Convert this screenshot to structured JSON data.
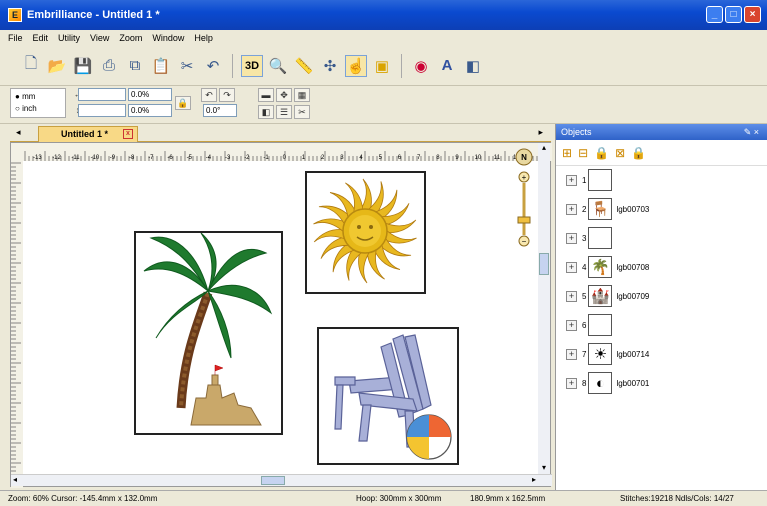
{
  "window": {
    "title": "Embrilliance - Untitled 1 *"
  },
  "menu": [
    "File",
    "Edit",
    "Utility",
    "View",
    "Zoom",
    "Window",
    "Help"
  ],
  "toolbar": {
    "icons": [
      "new-icon",
      "open-icon",
      "save-icon",
      "print-icon",
      "copy-icon",
      "paste-icon",
      "stitch-icon",
      "undo-icon",
      "3d-view-icon",
      "zoom-icon",
      "measure-icon",
      "hoop-icon",
      "select-icon",
      "fill-icon",
      "color-icon",
      "text-icon",
      "split-icon"
    ],
    "3d_label": "3D",
    "text_label": "A"
  },
  "units": {
    "mm": "mm",
    "inch": "inch"
  },
  "fields": {
    "width_pct": "0.0%",
    "height_pct": "0.0%",
    "rotation": "0.0°"
  },
  "doc_tab": {
    "label": "Untitled 1 *"
  },
  "ruler": [
    "-13",
    "-12",
    "-11",
    "-10",
    "-9",
    "-8",
    "-7",
    "-6",
    "-5",
    "-4",
    "-3",
    "-2",
    "-1",
    "0",
    "1",
    "2",
    "3",
    "4",
    "5",
    "6",
    "7",
    "8",
    "9",
    "10",
    "11",
    "12"
  ],
  "objects_panel": {
    "title": "Objects",
    "items": [
      {
        "num": "1",
        "name": "",
        "icon": "empty"
      },
      {
        "num": "2",
        "name": "lgb00703",
        "icon": "chair-icon"
      },
      {
        "num": "3",
        "name": "",
        "icon": "empty"
      },
      {
        "num": "4",
        "name": "lgb00708",
        "icon": "palm-icon"
      },
      {
        "num": "5",
        "name": "lgb00709",
        "icon": "sandcastle-icon"
      },
      {
        "num": "6",
        "name": "",
        "icon": "empty"
      },
      {
        "num": "7",
        "name": "lgb00714",
        "icon": "sun-icon"
      },
      {
        "num": "8",
        "name": "lgb00701",
        "icon": "beachball-icon"
      }
    ]
  },
  "status": {
    "zoom": "Zoom: 60%  Cursor: -145.4mm x 132.0mm",
    "hoop": "Hoop: 300mm x 300mm",
    "size": "180.9mm x 162.5mm",
    "stitches": "Stitches:19218  Ndls/Cols: 14/27"
  },
  "colors": {
    "title_bar": "#0a4ad0",
    "tab": "#f8d986",
    "panel_head": "#2f62c8"
  }
}
